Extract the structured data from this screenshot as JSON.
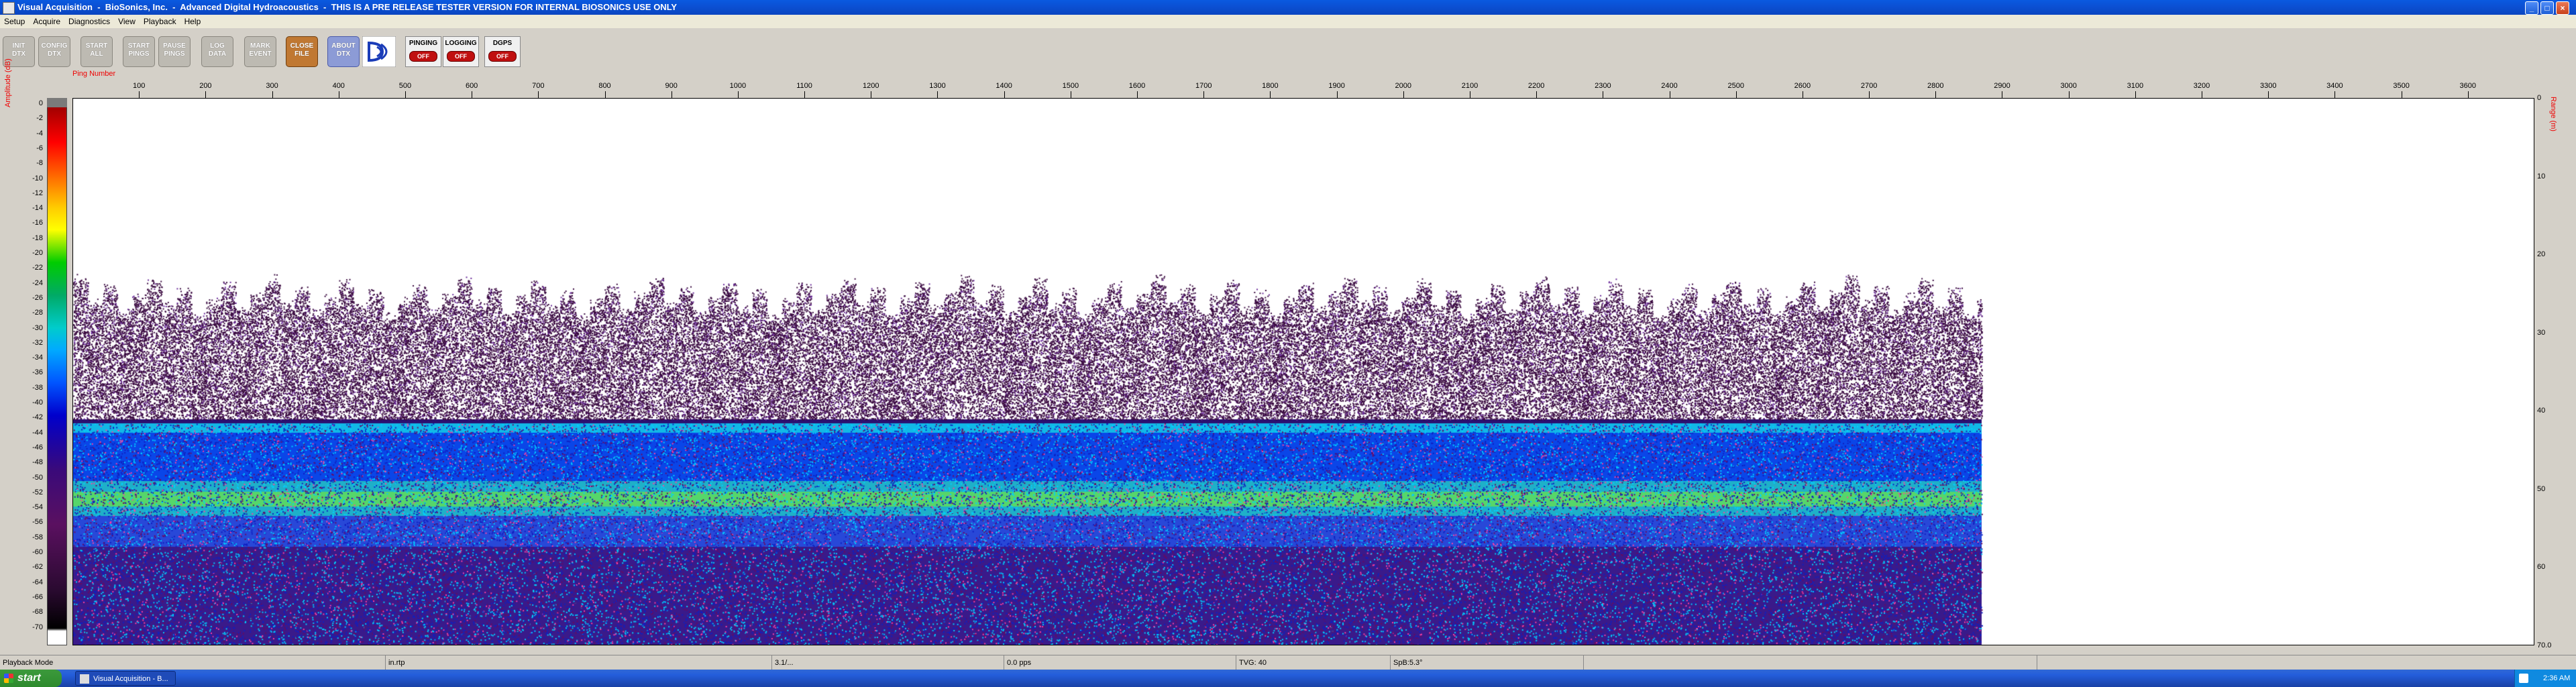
{
  "window": {
    "title": "Visual Acquisition  -  BioSonics, Inc.  -  Advanced Digital Hydroacoustics  -  THIS IS A PRE RELEASE TESTER VERSION FOR INTERNAL BIOSONICS USE ONLY",
    "minimize": "_",
    "maximize": "□",
    "close": "×"
  },
  "menu": [
    "Setup",
    "Acquire",
    "Diagnostics",
    "View",
    "Playback",
    "Help"
  ],
  "toolbar": {
    "buttons": [
      {
        "line1": "INIT",
        "line2": "DTX"
      },
      {
        "line1": "CONFIG",
        "line2": "DTX"
      },
      {
        "line1": "START",
        "line2": "ALL"
      },
      {
        "line1": "START",
        "line2": "PINGS"
      },
      {
        "line1": "PAUSE",
        "line2": "PINGS"
      },
      {
        "line1": "LOG",
        "line2": "DATA"
      },
      {
        "line1": "MARK",
        "line2": "EVENT"
      },
      {
        "line1": "CLOSE",
        "line2": "FILE"
      },
      {
        "line1": "ABOUT",
        "line2": "DTX"
      }
    ],
    "status": [
      {
        "label": "PINGING",
        "state": "OFF"
      },
      {
        "label": "LOGGING",
        "state": "OFF"
      },
      {
        "label": "DGPS",
        "state": "OFF"
      }
    ]
  },
  "plot": {
    "ping_label": "Ping Number",
    "amp_label": "Amplitude (dB)",
    "range_label": "Range (m)",
    "ping_ticks": [
      100,
      200,
      300,
      400,
      500,
      600,
      700,
      800,
      900,
      1000,
      1100,
      1200,
      1300,
      1400,
      1500,
      1600,
      1700,
      1800,
      1900,
      2000,
      2100,
      2200,
      2300,
      2400,
      2500,
      2600,
      2700,
      2800,
      2900,
      3000,
      3100,
      3200,
      3300,
      3400,
      3500,
      3600
    ],
    "amp_ticks": [
      "0",
      "-2",
      "-4",
      "-6",
      "-8",
      "-10",
      "-12",
      "-14",
      "-16",
      "-18",
      "-20",
      "-22",
      "-24",
      "-26",
      "-28",
      "-30",
      "-32",
      "-34",
      "-36",
      "-38",
      "-40",
      "-42",
      "-44",
      "-46",
      "-48",
      "-50",
      "-52",
      "-54",
      "-56",
      "-58",
      "-60",
      "-62",
      "-64",
      "-66",
      "-68",
      "-70"
    ],
    "range_ticks": [
      "0",
      "10",
      "20",
      "30",
      "40",
      "50",
      "60",
      "70.0"
    ],
    "ping_max": 3700,
    "range_max": 70,
    "data_end_ping": 2870
  },
  "statusbar": {
    "mode": "Playback Mode",
    "file": "in.rtp",
    "pings": "3.1/...",
    "rate": "0.0 pps",
    "tvg": "TVG: 40",
    "spb": "SpB:5.3°"
  },
  "taskbar": {
    "start": "start",
    "task": "Visual Acquisition - B...",
    "clock": "2:36 AM"
  },
  "colors": {
    "accent": "#0a5ae0",
    "red": "#e00000"
  }
}
